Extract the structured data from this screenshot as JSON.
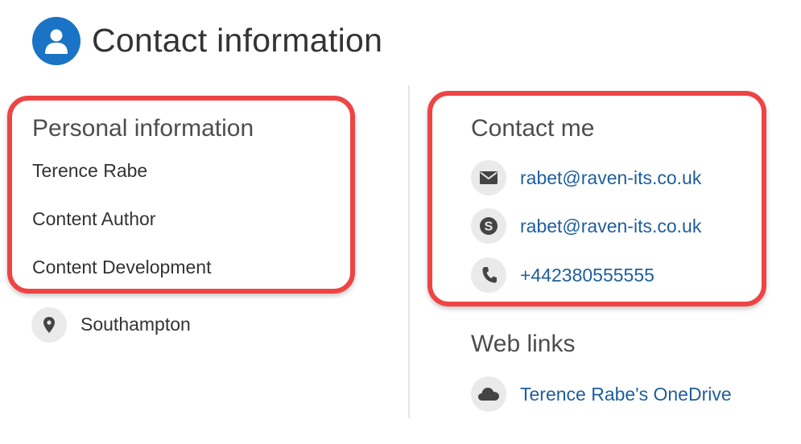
{
  "header": {
    "title": "Contact information",
    "icon": "person-icon",
    "accent_color": "#1a73c4"
  },
  "personal": {
    "heading": "Personal information",
    "name": "Terence Rabe",
    "job_title": "Content Author",
    "department": "Content Development",
    "location": {
      "icon": "location-pin-icon",
      "text": "Southampton"
    }
  },
  "contact": {
    "heading": "Contact me",
    "items": [
      {
        "icon": "email-icon",
        "text": "rabet@raven-its.co.uk"
      },
      {
        "icon": "skype-icon",
        "text": "rabet@raven-its.co.uk"
      },
      {
        "icon": "phone-icon",
        "text": "+442380555555"
      }
    ]
  },
  "web_links": {
    "heading": "Web links",
    "items": [
      {
        "icon": "onedrive-cloud-icon",
        "text": "Terence Rabe's OneDrive"
      }
    ]
  },
  "colors": {
    "highlight": "#ee4444",
    "link": "#1f5e9c"
  }
}
